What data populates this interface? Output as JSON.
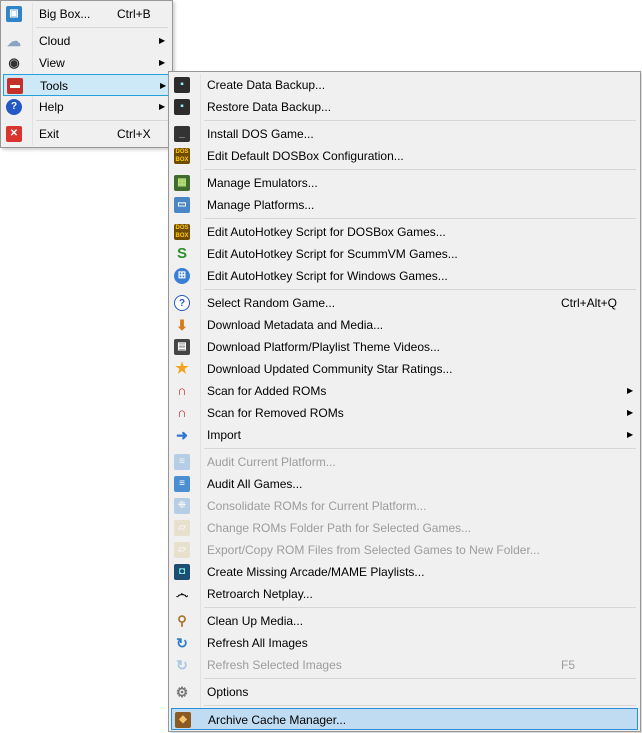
{
  "main_menu": {
    "items": [
      {
        "label": "Big Box...",
        "shortcut": "Ctrl+B",
        "icon": "big-box-icon",
        "glyph": "▣"
      },
      {
        "label": "Cloud",
        "icon": "cloud-icon",
        "glyph": "☁",
        "submenu": true
      },
      {
        "label": "View",
        "icon": "eye-icon",
        "glyph": "◉",
        "submenu": true
      },
      {
        "label": "Tools",
        "icon": "toolbox-icon",
        "glyph": "▬",
        "submenu": true,
        "active": true
      },
      {
        "label": "Help",
        "icon": "help-icon",
        "glyph": "?",
        "submenu": true
      },
      {
        "label": "Exit",
        "shortcut": "Ctrl+X",
        "icon": "exit-icon",
        "glyph": "✕"
      }
    ]
  },
  "tools_menu": {
    "items": [
      {
        "label": "Create Data Backup...",
        "icon": "backup-robot-icon"
      },
      {
        "label": "Restore Data Backup...",
        "icon": "restore-robot-icon"
      },
      {
        "label": "Install DOS Game...",
        "icon": "terminal-icon"
      },
      {
        "label": "Edit Default DOSBox Configuration...",
        "icon": "dosbox-icon"
      },
      {
        "label": "Manage Emulators...",
        "icon": "chip-icon"
      },
      {
        "label": "Manage Platforms...",
        "icon": "monitor-icon"
      },
      {
        "label": "Edit AutoHotkey Script for DOSBox Games...",
        "icon": "dosbox-icon"
      },
      {
        "label": "Edit AutoHotkey Script for ScummVM Games...",
        "icon": "scummvm-icon"
      },
      {
        "label": "Edit AutoHotkey Script for Windows Games...",
        "icon": "windows-icon"
      },
      {
        "label": "Select Random Game...",
        "shortcut": "Ctrl+Alt+Q",
        "icon": "question-icon"
      },
      {
        "label": "Download Metadata and Media...",
        "icon": "download-icon"
      },
      {
        "label": "Download Platform/Playlist Theme Videos...",
        "icon": "film-icon"
      },
      {
        "label": "Download Updated Community Star Ratings...",
        "icon": "star-icon"
      },
      {
        "label": "Scan for Added ROMs",
        "icon": "magnet-add-icon",
        "submenu": true
      },
      {
        "label": "Scan for Removed ROMs",
        "icon": "magnet-remove-icon",
        "submenu": true
      },
      {
        "label": "Import",
        "icon": "import-arrow-icon",
        "submenu": true
      },
      {
        "label": "Audit Current Platform...",
        "icon": "audit-list-icon",
        "disabled": true
      },
      {
        "label": "Audit All Games...",
        "icon": "audit-list-icon"
      },
      {
        "label": "Consolidate ROMs for Current Platform...",
        "icon": "consolidate-icon",
        "disabled": true
      },
      {
        "label": "Change ROMs Folder Path for Selected Games...",
        "icon": "folder-icon",
        "disabled": true
      },
      {
        "label": "Export/Copy ROM Files from Selected Games to New Folder...",
        "icon": "export-folder-icon",
        "disabled": true
      },
      {
        "label": "Create Missing Arcade/MAME Playlists...",
        "icon": "arcade-icon"
      },
      {
        "label": "Retroarch Netplay...",
        "icon": "mustache-icon"
      },
      {
        "label": "Clean Up Media...",
        "icon": "broom-icon"
      },
      {
        "label": "Refresh All Images",
        "icon": "refresh-icon"
      },
      {
        "label": "Refresh Selected Images",
        "shortcut": "F5",
        "icon": "refresh-icon",
        "disabled": true
      },
      {
        "label": "Options",
        "icon": "gear-icon",
        "disabled_icon": true
      },
      {
        "label": "Archive Cache Manager...",
        "icon": "archive-cube-icon",
        "highlight": true
      }
    ]
  },
  "colors": {
    "menu_bg": "#f0f0f0",
    "hover_bg": "#cde8f7",
    "hover_border": "#26a0da",
    "disabled_text": "#9c9c9c"
  }
}
